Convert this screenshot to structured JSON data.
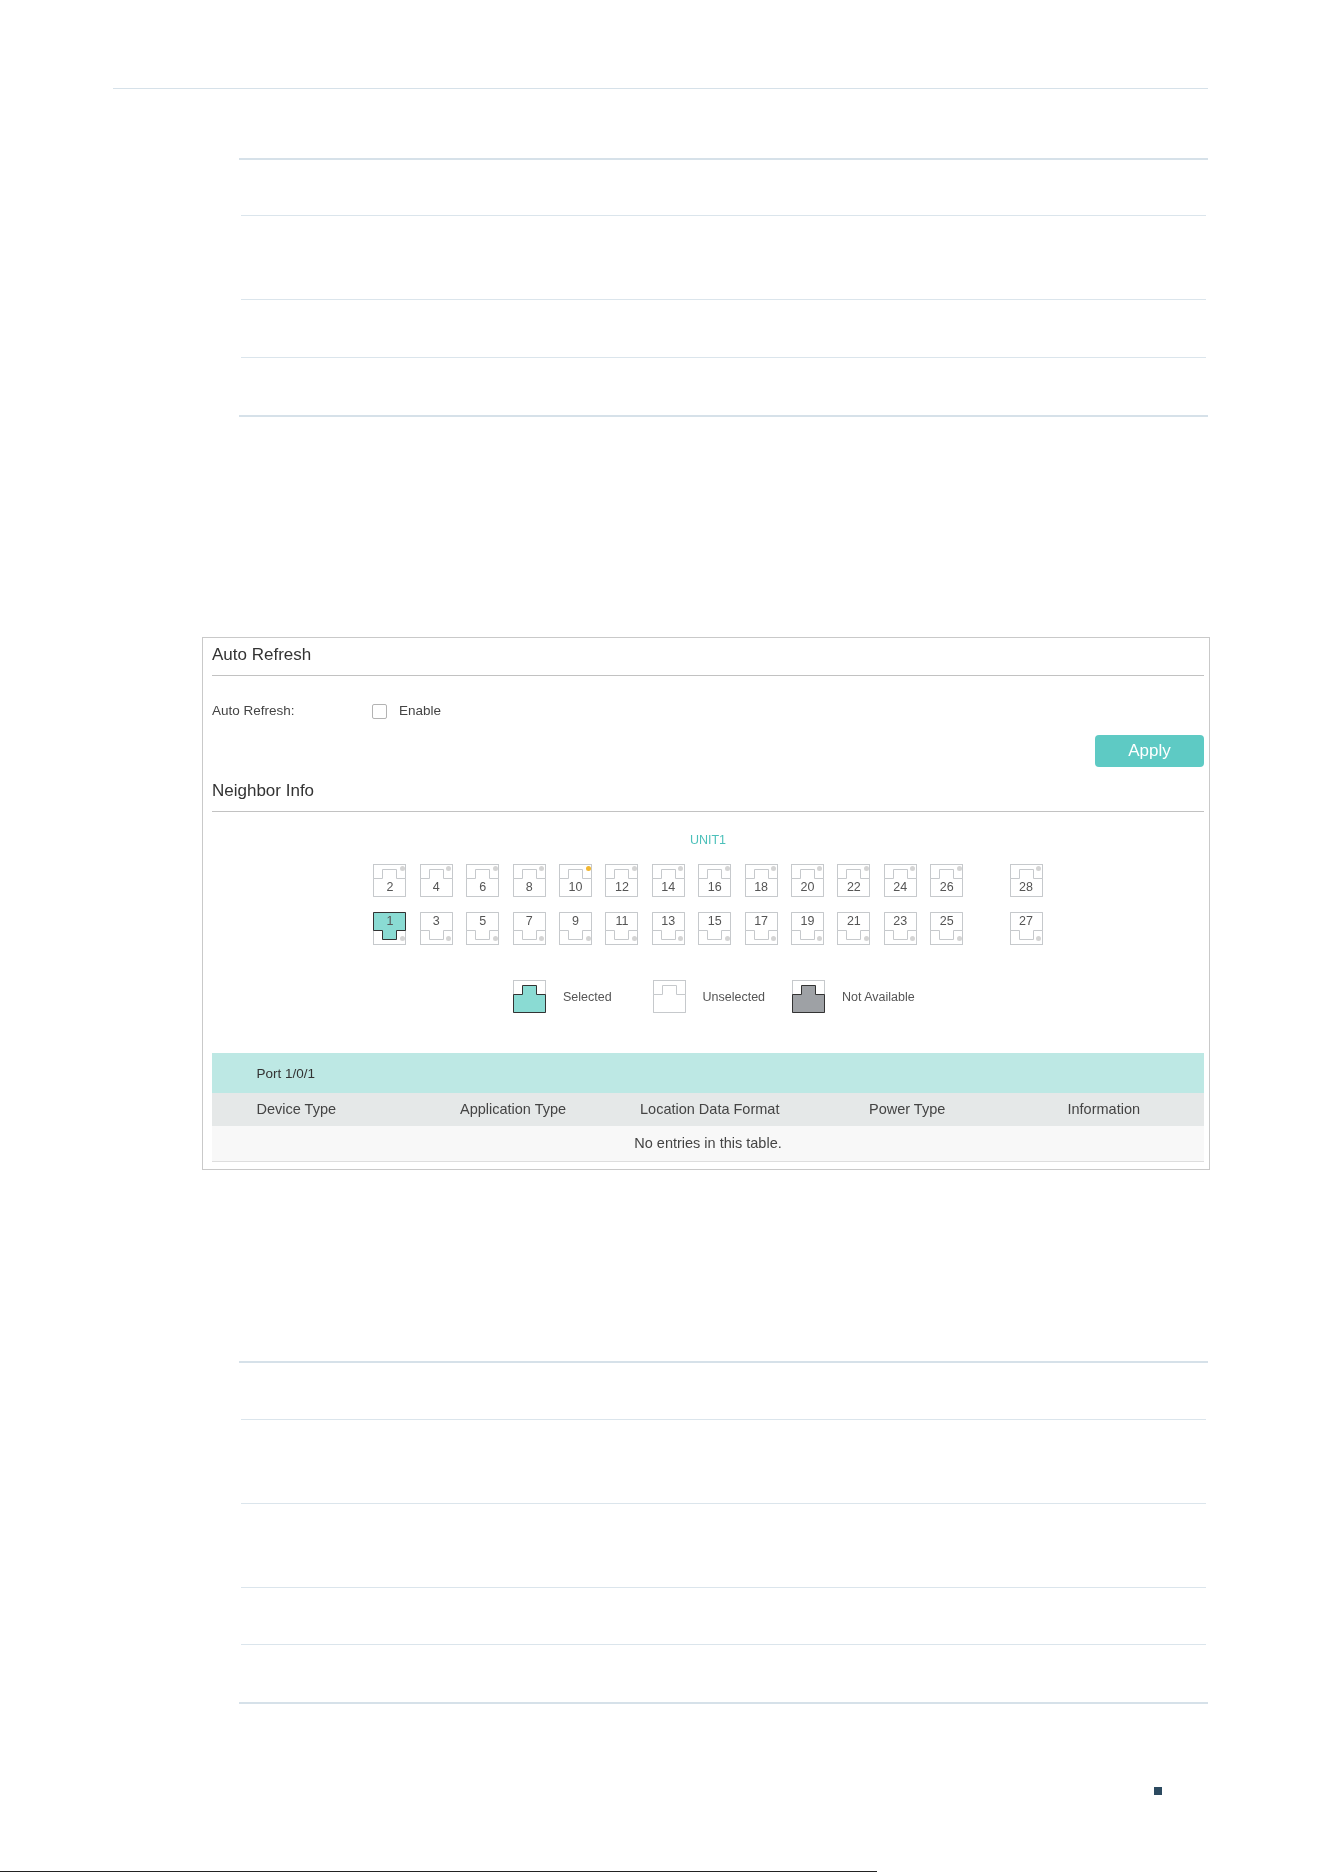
{
  "auto_refresh": {
    "title": "Auto Refresh",
    "label": "Auto Refresh:",
    "enable": {
      "label": "Enable",
      "checked": false
    },
    "apply_button": "Apply"
  },
  "neighbor_info": {
    "title": "Neighbor Info",
    "unit": "UNIT1",
    "port_groups": [
      {
        "top": [
          {
            "number": "2",
            "selected": false,
            "color": "#d4d4d4"
          },
          {
            "number": "4",
            "selected": false,
            "color": "#d4d4d4"
          },
          {
            "number": "6",
            "selected": false,
            "color": "#d4d4d4"
          },
          {
            "number": "8",
            "selected": false,
            "color": "#d4d4d4"
          },
          {
            "number": "10",
            "selected": false,
            "color": "#f2b630"
          },
          {
            "number": "12",
            "selected": false,
            "color": "#d4d4d4"
          },
          {
            "number": "14",
            "selected": false,
            "color": "#d4d4d4"
          },
          {
            "number": "16",
            "selected": false,
            "color": "#d4d4d4"
          },
          {
            "number": "18",
            "selected": false,
            "color": "#d4d4d4"
          },
          {
            "number": "20",
            "selected": false,
            "color": "#d4d4d4"
          },
          {
            "number": "22",
            "selected": false,
            "color": "#d4d4d4"
          },
          {
            "number": "24",
            "selected": false,
            "color": "#d4d4d4"
          },
          {
            "number": "26",
            "selected": false,
            "color": "#d4d4d4"
          }
        ],
        "bottom": [
          {
            "number": "1",
            "selected": true,
            "color": "#d4d4d4"
          },
          {
            "number": "3",
            "selected": false,
            "color": "#d4d4d4"
          },
          {
            "number": "5",
            "selected": false,
            "color": "#d4d4d4"
          },
          {
            "number": "7",
            "selected": false,
            "color": "#d4d4d4"
          },
          {
            "number": "9",
            "selected": false,
            "color": "#d4d4d4"
          },
          {
            "number": "11",
            "selected": false,
            "color": "#d4d4d4"
          },
          {
            "number": "13",
            "selected": false,
            "color": "#d4d4d4"
          },
          {
            "number": "15",
            "selected": false,
            "color": "#d4d4d4"
          },
          {
            "number": "17",
            "selected": false,
            "color": "#d4d4d4"
          },
          {
            "number": "19",
            "selected": false,
            "color": "#d4d4d4"
          },
          {
            "number": "21",
            "selected": false,
            "color": "#d4d4d4"
          },
          {
            "number": "23",
            "selected": false,
            "color": "#d4d4d4"
          },
          {
            "number": "25",
            "selected": false,
            "color": "#d4d4d4"
          }
        ]
      },
      {
        "top": [
          {
            "number": "28",
            "selected": false,
            "color": "#d4d4d4"
          }
        ],
        "bottom": [
          {
            "number": "27",
            "selected": false,
            "color": "#d4d4d4"
          }
        ]
      }
    ],
    "legend": [
      {
        "kind": "selected",
        "label": "Selected"
      },
      {
        "kind": "unselected",
        "label": "Unselected"
      },
      {
        "kind": "unavailable",
        "label": "Not Available"
      }
    ],
    "port_table": {
      "title": "Port 1/0/1",
      "columns": [
        "Device Type",
        "Application Type",
        "Location Data Format",
        "Power Type",
        "Information"
      ],
      "empty_message": "No entries in this table."
    }
  }
}
